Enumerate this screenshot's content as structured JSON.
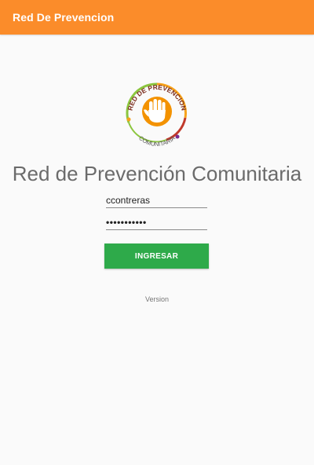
{
  "app_bar": {
    "title": "Red De Prevencion",
    "color": "#fb8c2a"
  },
  "logo": {
    "icon": "raised-hand-logo",
    "top_text": "RED DE PREVENCION",
    "bottom_text": "COMUNITARIA"
  },
  "main": {
    "title": "Red de Prevención Comunitaria"
  },
  "login_form": {
    "username_value": "ccontreras",
    "password_value": "•••••••••••",
    "submit_label": "INGRESAR",
    "submit_color": "#2eaa4a"
  },
  "footer": {
    "version_label": "Version"
  }
}
